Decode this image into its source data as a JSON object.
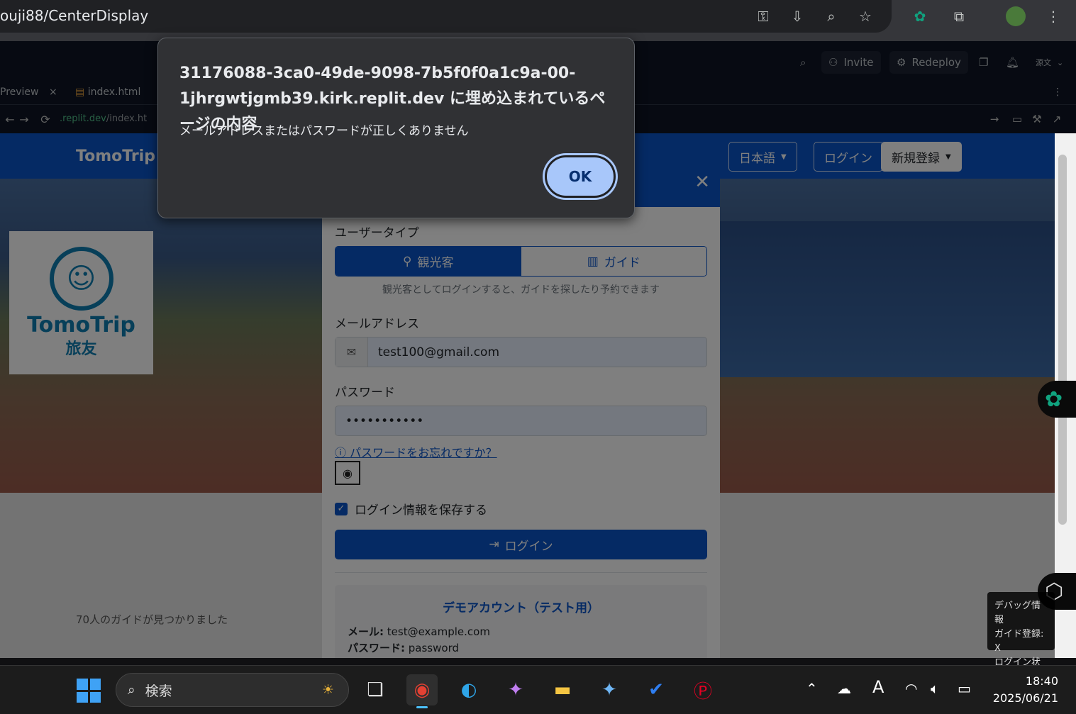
{
  "browser": {
    "url_fragment": "ouji88/CenterDisplay"
  },
  "replit_header": {
    "invite_label": "Invite",
    "redeploy_label": "Redeploy",
    "avatar_text": "源文"
  },
  "tabs": [
    {
      "label": "Preview"
    },
    {
      "label": "index.html"
    }
  ],
  "devbar": {
    "address_host": ".replit.dev",
    "address_path": "/index.ht"
  },
  "site": {
    "brand": "TomoTrip",
    "lang_label": "日本語",
    "login_label": "ログイン",
    "register_label": "新規登録",
    "logo_title": "TomoTrip",
    "logo_subtitle": "旅友",
    "guides_count_text": "70人のガイドが見つかりました"
  },
  "modal": {
    "user_type_label": "ユーザータイプ",
    "tourist_label": "観光客",
    "guide_label": "ガイド",
    "hint": "観光客としてログインすると、ガイドを探したり予約できます",
    "email_label": "メールアドレス",
    "email_value": "test100@gmail.com",
    "password_label": "パスワード",
    "password_value": "•••••••••••",
    "forgot_label": "パスワードをお忘れですか？",
    "remember_label": "ログイン情報を保存する",
    "login_button": "ログイン",
    "demo_title": "デモアカウント（テスト用）",
    "demo_email_label": "メール:",
    "demo_email_value": "test@example.com",
    "demo_password_label": "パスワード:",
    "demo_password_value": "password"
  },
  "debug": {
    "title": "デバッグ情報",
    "line1": "ガイド登録: X",
    "line2": "ログイン状態: X"
  },
  "alert": {
    "title": "31176088-3ca0-49de-9098-7b5f0f0a1c9a-00-1jhrgwtjgmb39.kirk.replit.dev に埋め込まれているページの内容",
    "message": "メールアドレスまたはパスワードが正しくありません",
    "ok_label": "OK"
  },
  "taskbar": {
    "search_placeholder": "検索",
    "ime_label": "A",
    "time": "18:40",
    "date": "2025/06/21"
  },
  "colors": {
    "brand_blue": "#0a55c9",
    "alert_button": "#a8c7fa"
  }
}
